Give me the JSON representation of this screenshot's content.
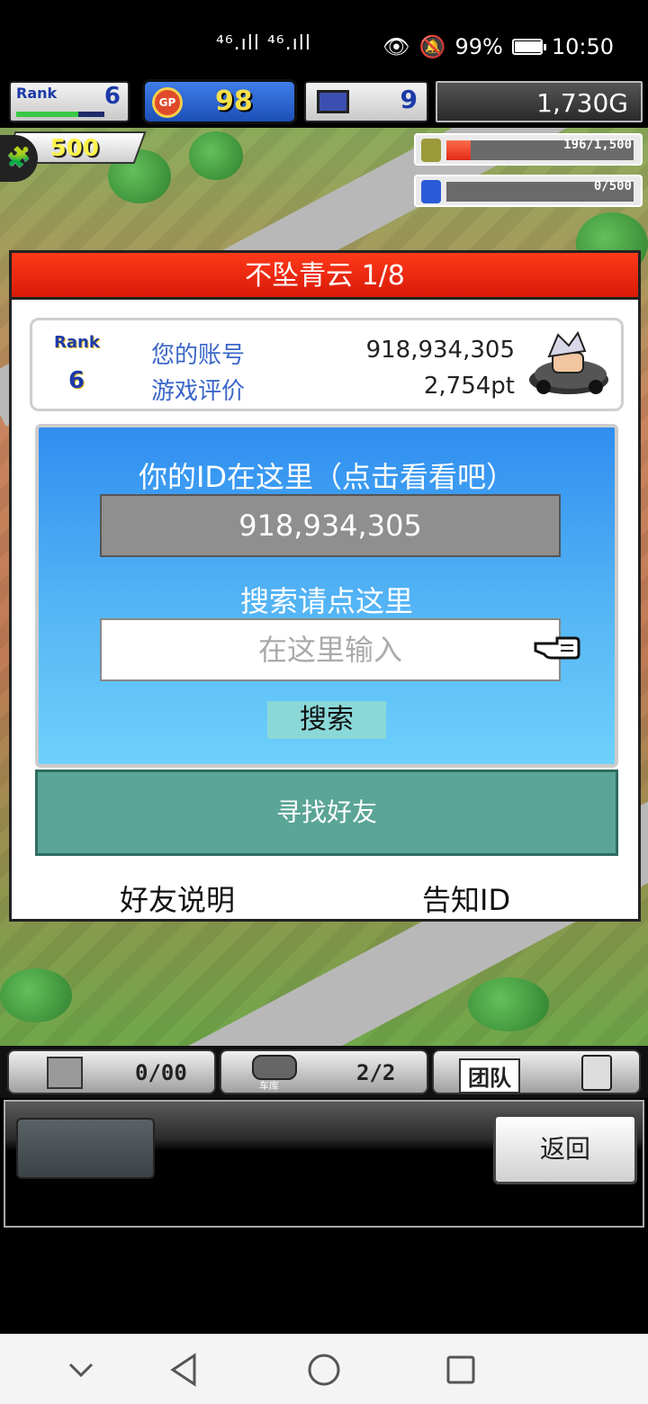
{
  "status_bar": {
    "network": "⁴⁶.ıll ⁴⁶.ıll",
    "battery": "99%",
    "time": "10:50",
    "battery_level": 0.99
  },
  "hud": {
    "rank_label": "Rank",
    "rank_value": "6",
    "gp_label": "GP",
    "gp_value": "98",
    "pc_value": "9",
    "money": "1,730G",
    "sub_value": "500",
    "meter1": {
      "text": "196/1,500",
      "fraction": 0.13
    },
    "meter2": {
      "text": "0/500",
      "fraction": 0
    }
  },
  "dialog": {
    "title": "不坠青云 1/8",
    "rank_label": "Rank",
    "rank_value": "6",
    "account_label": "您的账号",
    "account_value": "918,934,305",
    "rating_label": "游戏评价",
    "rating_value": "2,754pt",
    "id_hint": "你的ID在这里（点击看看吧）",
    "id_value": "918,934,305",
    "search_hint": "搜索请点这里",
    "search_placeholder": "在这里输入",
    "search_button": "搜索",
    "find_friend_button": "寻找好友",
    "friend_help_link": "好友说明",
    "share_id_link": "告知ID"
  },
  "bottom": {
    "tab1_value": "0/00",
    "tab2_value": "2/2",
    "tab2_caption": "车库",
    "tab3_label": "团队",
    "return_button": "返回"
  },
  "colors": {
    "title_red": "#e8220f",
    "panel_blue": "#3a98f0",
    "find_button_teal": "#5ba596"
  }
}
